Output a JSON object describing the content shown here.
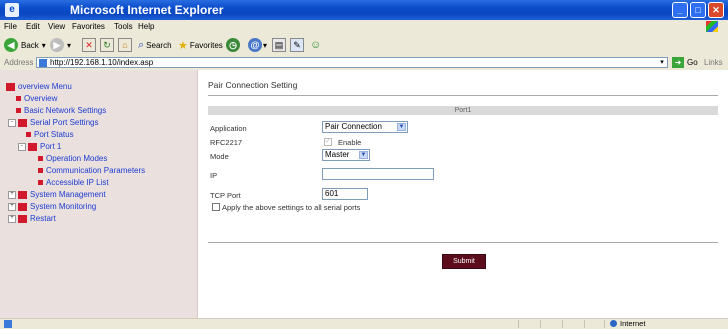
{
  "window": {
    "title": "Microsoft Internet Explorer"
  },
  "menu": [
    "File",
    "Edit",
    "View",
    "Favorites",
    "Tools",
    "Help"
  ],
  "toolbar": {
    "back_label": "Back",
    "search_label": "Search",
    "favorites_label": "Favorites"
  },
  "address": {
    "label": "Address",
    "url": "http://192.168.1.10/index.asp",
    "go_label": "Go",
    "links_label": "Links"
  },
  "sidebar": {
    "items": [
      {
        "label": "overview Menu"
      },
      {
        "label": "Overview"
      },
      {
        "label": "Basic Network Settings"
      },
      {
        "label": "Serial Port Settings"
      },
      {
        "label": "Port Status"
      },
      {
        "label": "Port 1"
      },
      {
        "label": "Operation Modes"
      },
      {
        "label": "Communication Parameters"
      },
      {
        "label": "Accessible IP List"
      },
      {
        "label": "System Management"
      },
      {
        "label": "System Monitoring"
      },
      {
        "label": "Restart"
      }
    ]
  },
  "main": {
    "page_title": "Pair Connection Setting",
    "port_header": "Port1",
    "fields": {
      "application": {
        "label": "Application",
        "value": "Pair Connection"
      },
      "rfc2217": {
        "label": "RFC2217",
        "option_label": "Enable",
        "checked": true
      },
      "mode": {
        "label": "Mode",
        "value": "Master"
      },
      "ip": {
        "label": "IP",
        "value": ""
      },
      "tcp_port": {
        "label": "TCP Port",
        "value": "601"
      }
    },
    "apply_all_label": "Apply the above settings to all serial ports",
    "submit_label": "Submit"
  },
  "status": {
    "zone_label": "Internet"
  }
}
